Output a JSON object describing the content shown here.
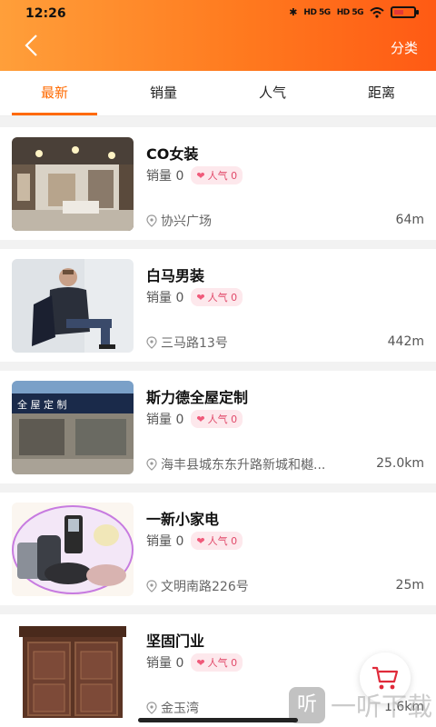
{
  "status": {
    "time": "12:26",
    "signal1": "HD 5G",
    "signal2": "HD 5G"
  },
  "header": {
    "category_label": "分类"
  },
  "tabs": [
    {
      "label": "最新",
      "active": true
    },
    {
      "label": "销量",
      "active": false
    },
    {
      "label": "人气",
      "active": false
    },
    {
      "label": "距离",
      "active": false
    }
  ],
  "stores": [
    {
      "name": "CO女装",
      "sales": "销量 0",
      "popularity": "人气 0",
      "address": "协兴广场",
      "distance": "64m",
      "icon": "store-interior"
    },
    {
      "name": "白马男装",
      "sales": "销量 0",
      "popularity": "人气 0",
      "address": "三马路13号",
      "distance": "442m",
      "icon": "menswear-model"
    },
    {
      "name": "斯力德全屋定制",
      "sales": "销量 0",
      "popularity": "人气 0",
      "address": "海丰县城东东升路新城和樾...",
      "distance": "25.0km",
      "icon": "shopfront-banner"
    },
    {
      "name": "一新小家电",
      "sales": "销量 0",
      "popularity": "人气 0",
      "address": "文明南路226号",
      "distance": "25m",
      "icon": "home-appliances"
    },
    {
      "name": "坚固门业",
      "sales": "销量 0",
      "popularity": "人气 0",
      "address": "金玉湾",
      "distance": "1.6km",
      "icon": "wooden-door"
    }
  ],
  "thumb_texts": {
    "banner": "全 屋 定 制"
  },
  "watermark": {
    "logo": "听",
    "text": "一听下载"
  },
  "colors": {
    "accent": "#ff6a00",
    "header_start": "#ff9f3a",
    "header_end": "#ff5a14",
    "badge_bg": "#fde8ec",
    "badge_text": "#e14a6a"
  }
}
